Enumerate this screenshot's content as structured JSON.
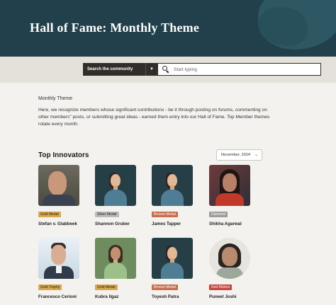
{
  "header": {
    "title": "Hall of Fame: Monthly Theme"
  },
  "search": {
    "scope_label": "Search the community",
    "placeholder": "Start typing"
  },
  "content": {
    "section_label": "Monthly Theme",
    "intro": "Here, we recognize members whose significant contributions - be it through posting on forums, commenting on other members\" posts, or submitting great ideas - earned them entry into our Hall of Fame. Top Member themes rotate every month.",
    "list_title": "Top Innovators",
    "month_selected": "November, 2024"
  },
  "members": [
    {
      "name": "Stefan v. Glabbeek",
      "badge": "Gold Medal",
      "badge_color": "#d8a94e"
    },
    {
      "name": "Shannon Gruber",
      "badge": "Silver Medal",
      "badge_color": "#bcbcbc"
    },
    {
      "name": "James Tapper",
      "badge": "Bronze Medal",
      "badge_color": "#c86e4e"
    },
    {
      "name": "Shikha Agarwal",
      "badge": "Diamond",
      "badge_color": "#9b9b9b"
    },
    {
      "name": "Francesco Cerioni",
      "badge": "Gold Trophy",
      "badge_color": "#d8a94e"
    },
    {
      "name": "Kubra Ilgaz",
      "badge": "Gold Medal",
      "badge_color": "#d8a94e"
    },
    {
      "name": "Toyesh Patra",
      "badge": "Bronze Medal",
      "badge_color": "#c86e4e"
    },
    {
      "name": "Puneet Joshi",
      "badge": "Red Ribbon",
      "badge_color": "#c8453e"
    }
  ],
  "colors": {
    "header_bg": "#22404b",
    "page_bg": "#f4f2ef",
    "search_dark": "#312d2a"
  },
  "icons": {
    "search": "search-icon",
    "dropdown": "chevron-down-icon"
  }
}
